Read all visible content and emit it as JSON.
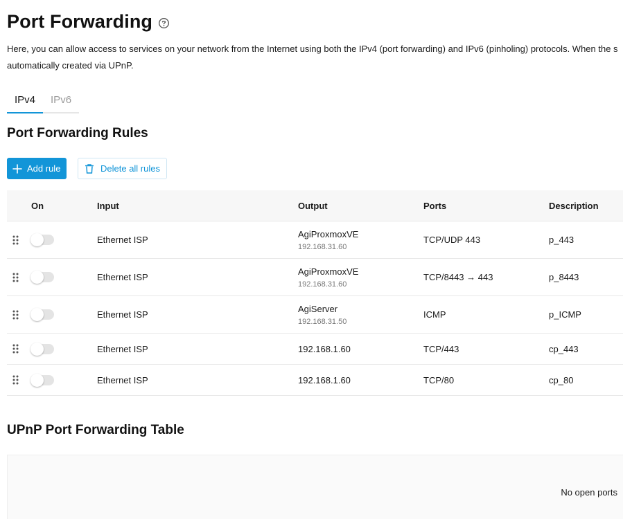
{
  "page": {
    "title": "Port Forwarding",
    "help_icon": "help-circle-icon",
    "intro_line1": "Here, you can allow access to services on your network from the Internet using both the IPv4 (port forwarding) and IPv6 (pinholing) protocols. When the s",
    "intro_line2": "automatically created via UPnP."
  },
  "tabs": [
    {
      "label": "IPv4",
      "active": true
    },
    {
      "label": "IPv6",
      "active": false
    }
  ],
  "rules": {
    "title": "Port Forwarding Rules",
    "add_label": "Add rule",
    "delete_label": "Delete all rules",
    "columns": {
      "on": "On",
      "input": "Input",
      "output": "Output",
      "ports": "Ports",
      "description": "Description"
    },
    "rows": [
      {
        "enabled": false,
        "input": "Ethernet ISP",
        "output": "AgiProxmoxVE",
        "output_ip": "192.168.31.60",
        "ports": "TCP/UDP 443",
        "description": "p_443"
      },
      {
        "enabled": false,
        "input": "Ethernet ISP",
        "output": "AgiProxmoxVE",
        "output_ip": "192.168.31.60",
        "ports": "TCP/8443 → 443",
        "description": "p_8443"
      },
      {
        "enabled": false,
        "input": "Ethernet ISP",
        "output": "AgiServer",
        "output_ip": "192.168.31.50",
        "ports": "ICMP",
        "description": "p_ICMP"
      },
      {
        "enabled": false,
        "input": "Ethernet ISP",
        "output": "192.168.1.60",
        "output_ip": "",
        "ports": "TCP/443",
        "description": "cp_443"
      },
      {
        "enabled": false,
        "input": "Ethernet ISP",
        "output": "192.168.1.60",
        "output_ip": "",
        "ports": "TCP/80",
        "description": "cp_80"
      }
    ]
  },
  "upnp": {
    "title": "UPnP Port Forwarding Table",
    "empty_text": "No open ports"
  },
  "colors": {
    "accent": "#1295d8",
    "toggle_off": "#e4e4e4",
    "header_bg": "#f7f7f7"
  }
}
